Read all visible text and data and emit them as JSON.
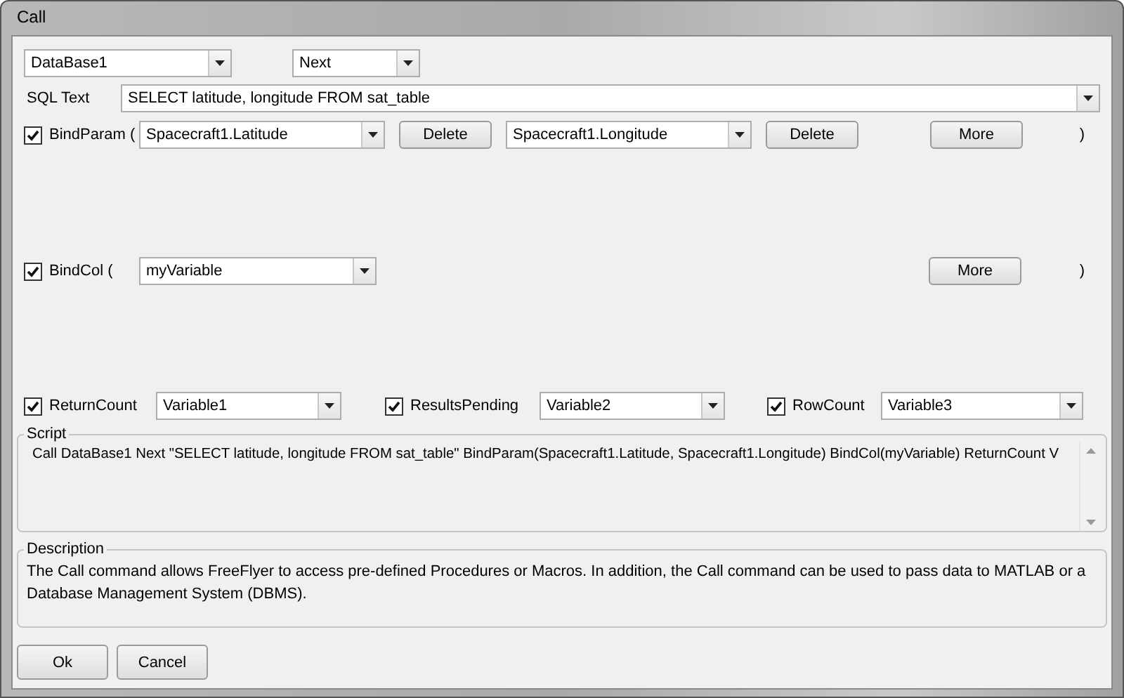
{
  "window": {
    "title": "Call"
  },
  "database": {
    "value": "DataBase1"
  },
  "action": {
    "value": "Next"
  },
  "sql_text": {
    "label": "SQL Text",
    "value": "SELECT latitude, longitude FROM sat_table"
  },
  "bind_param": {
    "checked": true,
    "label": "BindParam (",
    "params": [
      {
        "value": "Spacecraft1.Latitude",
        "delete": "Delete"
      },
      {
        "value": "Spacecraft1.Longitude",
        "delete": "Delete"
      }
    ],
    "more": "More",
    "close": ")"
  },
  "bind_col": {
    "checked": true,
    "label": "BindCol (",
    "columns": [
      {
        "value": "myVariable"
      }
    ],
    "more": "More",
    "close": ")"
  },
  "outputs": [
    {
      "label": "ReturnCount",
      "checked": true,
      "value": "Variable1"
    },
    {
      "label": "ResultsPending",
      "checked": true,
      "value": "Variable2"
    },
    {
      "label": "RowCount",
      "checked": true,
      "value": "Variable3"
    }
  ],
  "script": {
    "legend": "Script",
    "text": "Call DataBase1 Next \"SELECT latitude, longitude FROM sat_table\" BindParam(Spacecraft1.Latitude, Spacecraft1.Longitude) BindCol(myVariable) ReturnCount V"
  },
  "description": {
    "legend": "Description",
    "text": "The Call command allows FreeFlyer to access pre-defined Procedures or Macros. In addition, the Call command can be used to pass data to MATLAB or a Database Management System (DBMS)."
  },
  "buttons": [
    {
      "label": "Ok"
    },
    {
      "label": "Cancel"
    }
  ]
}
